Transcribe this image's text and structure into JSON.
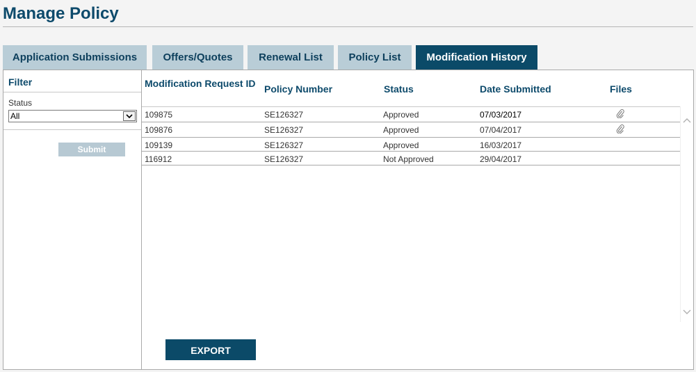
{
  "page": {
    "title": "Manage Policy"
  },
  "tabs": [
    {
      "label": "Application Submissions",
      "active": false
    },
    {
      "label": "Offers/Quotes",
      "active": false
    },
    {
      "label": "Renewal List",
      "active": false
    },
    {
      "label": "Policy List",
      "active": false
    },
    {
      "label": "Modification History",
      "active": true
    }
  ],
  "filter": {
    "title": "Filter",
    "status_label": "Status",
    "status_value": "All",
    "submit_label": "Submit"
  },
  "table": {
    "columns": [
      "Modification Request ID",
      "Policy Number",
      "Status",
      "Date Submitted",
      "Files"
    ],
    "rows": [
      {
        "id": "109875",
        "policy": "SE126327",
        "status": "Approved",
        "date": "07/03/2017",
        "has_file": true
      },
      {
        "id": "109876",
        "policy": "SE126327",
        "status": "Approved",
        "date": "07/04/2017",
        "has_file": true
      },
      {
        "id": "109139",
        "policy": "SE126327",
        "status": "Approved",
        "date": "16/03/2017",
        "has_file": false
      },
      {
        "id": "116912",
        "policy": "SE126327",
        "status": "Not Approved",
        "date": "29/04/2017",
        "has_file": false
      }
    ]
  },
  "export_label": "EXPORT",
  "icons": {
    "file": "paperclip-icon",
    "scroll_up": "chevron-up-icon",
    "scroll_down": "chevron-down-icon",
    "select_arrow": "chevron-down-icon"
  },
  "colors": {
    "brand": "#0b4a68",
    "tab_inactive": "#b9cdd7",
    "submit_disabled": "#b7c9d3"
  }
}
